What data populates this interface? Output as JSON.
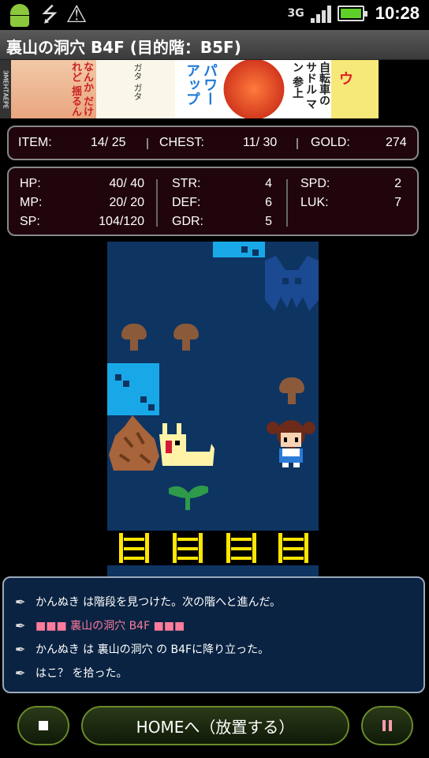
{
  "status_bar": {
    "network": "3G",
    "time": "10:28",
    "icons": [
      "android-icon",
      "usb-icon",
      "warning-icon",
      "signal-icon",
      "battery-icon"
    ]
  },
  "title": "裏山の洞穴 B4F (目的階：B5F)",
  "ad": {
    "side_text": "ЭМЕНТАЕРЕ",
    "girl_text": "なんか だけれど 揺るん",
    "rider_text": "ガタ ガタ",
    "power_text": "パワー アップ",
    "bike_text": "自転車の サドル マン 参上",
    "last_text": "ウ"
  },
  "inventory": {
    "item_label": "ITEM:",
    "item_value": "14/ 25",
    "chest_label": "CHEST:",
    "chest_value": "11/ 30",
    "gold_label": "GOLD:",
    "gold_value": "274"
  },
  "stats": {
    "hp_label": "HP:",
    "hp_value": "40/ 40",
    "mp_label": "MP:",
    "mp_value": "20/ 20",
    "sp_label": "SP:",
    "sp_value": "104/120",
    "str_label": "STR:",
    "str_value": "4",
    "def_label": "DEF:",
    "def_value": "6",
    "gdr_label": "GDR:",
    "gdr_value": "5",
    "spd_label": "SPD:",
    "spd_value": "2",
    "luk_label": "LUK:",
    "luk_value": "7"
  },
  "log": [
    {
      "text": "かんぬき は階段を見つけた。次の階へと進んだ。"
    },
    {
      "text": "■■■ 裏山の洞穴 B4F ■■■"
    },
    {
      "text": "かんぬき は 裏山の洞穴 の B4Fに降り立った。"
    },
    {
      "text": "はこ？ を拾った。"
    }
  ],
  "buttons": {
    "home": "HOMEへ（放置する）"
  },
  "colors": {
    "panel_bg": "#20060c",
    "dungeon_floor": "#0e3462",
    "water": "#18a8e8",
    "ladder": "#ffe600",
    "log_highlight": "#ff7b9c",
    "button_border": "#6a8a2a"
  }
}
